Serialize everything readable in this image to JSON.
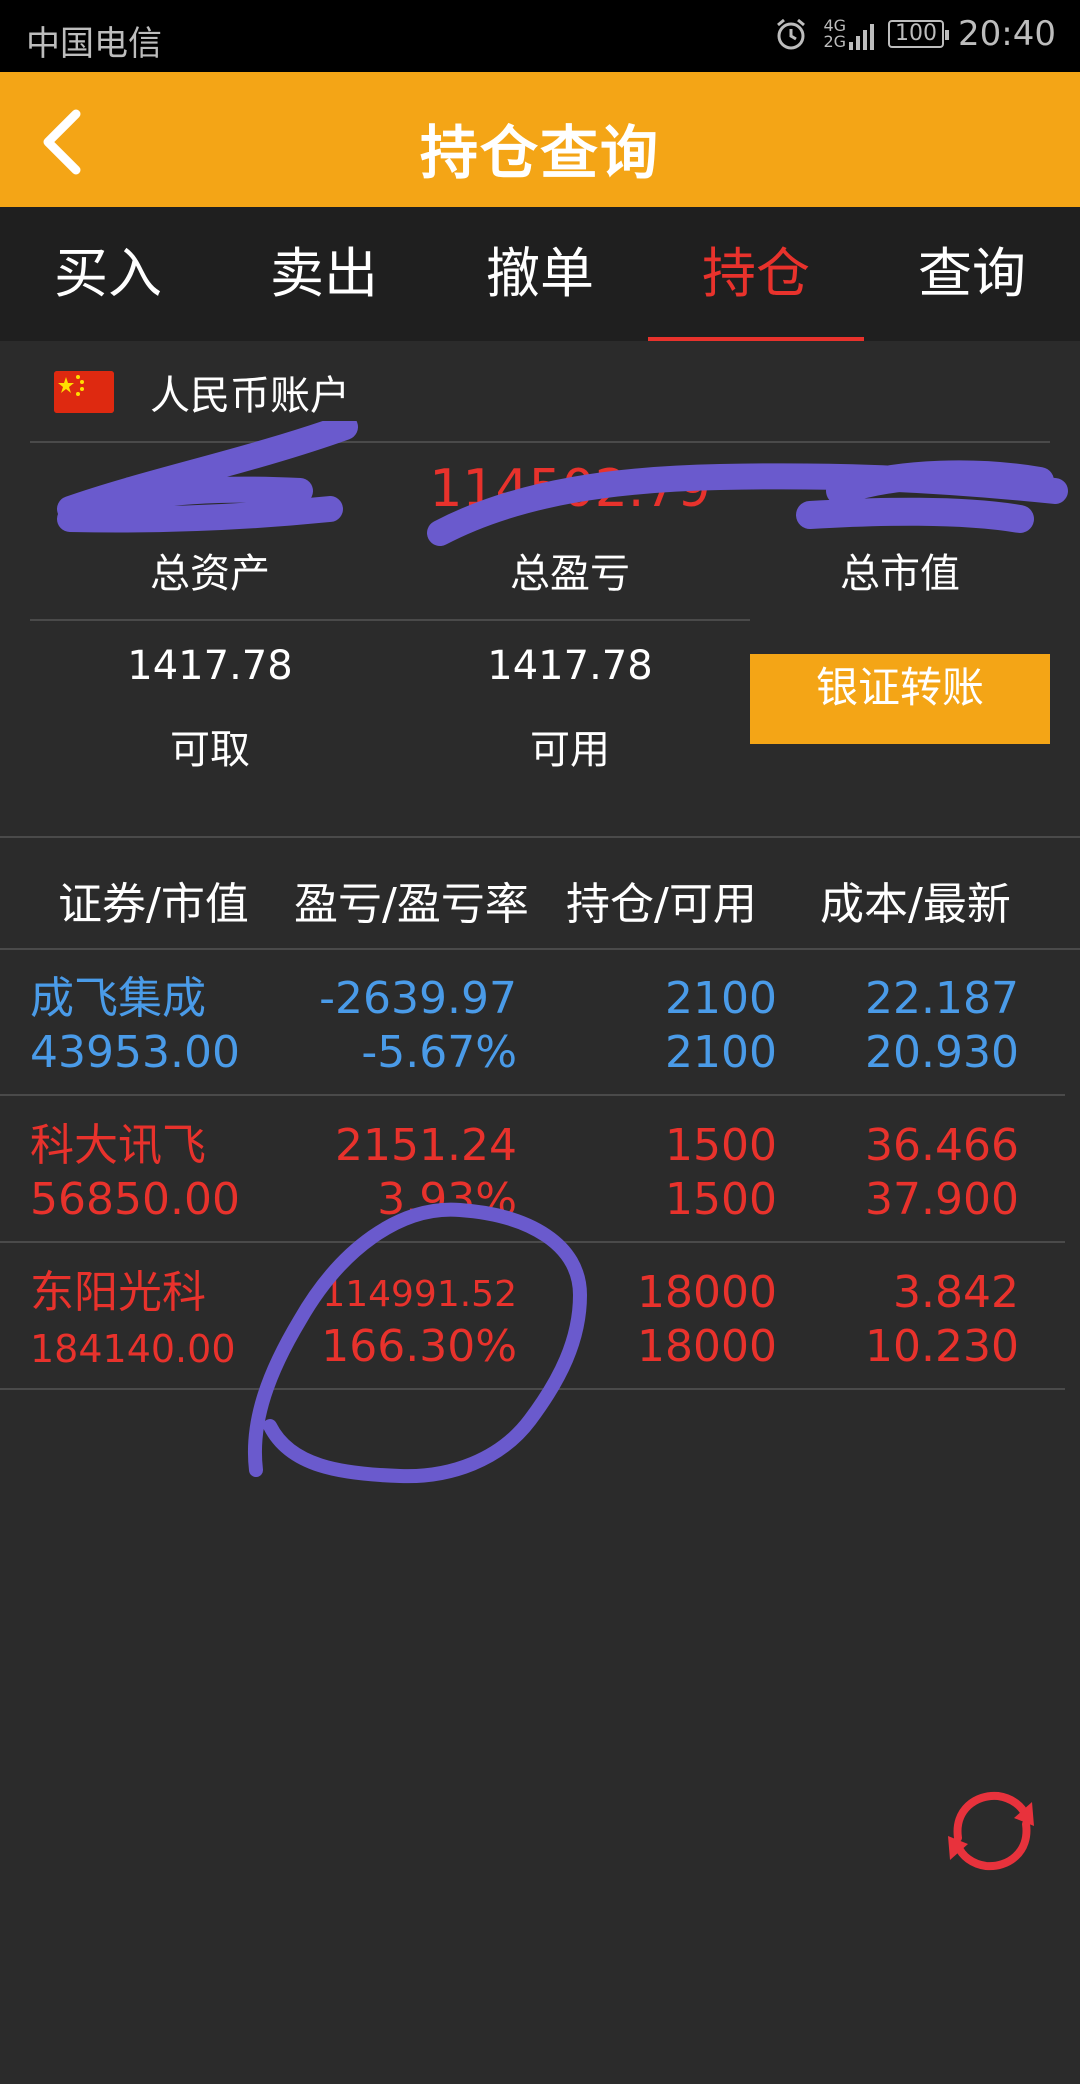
{
  "status_bar": {
    "carrier": "中国电信",
    "network": "4G",
    "network2": "2G",
    "battery": "100",
    "time": "20:40"
  },
  "header": {
    "title": "持仓查询"
  },
  "tabs": [
    "买入",
    "卖出",
    "撤单",
    "持仓",
    "查询"
  ],
  "active_tab": 3,
  "account": {
    "label": "人民币账户",
    "total_assets_label": "总资产",
    "total_pnl_label": "总盈亏",
    "total_pnl_value": "114502.79",
    "market_value_label": "总市值",
    "withdrawable_value": "1417.78",
    "withdrawable_label": "可取",
    "available_value": "1417.78",
    "available_label": "可用",
    "transfer_button": "银证转账"
  },
  "table": {
    "headers": [
      "证券/市值",
      "盈亏/盈亏率",
      "持仓/可用",
      "成本/最新"
    ],
    "rows": [
      {
        "name": "成飞集成",
        "market_value": "43953.00",
        "pnl": "-2639.97",
        "pnl_rate": "-5.67%",
        "position": "2100",
        "available": "2100",
        "cost": "22.187",
        "latest": "20.930",
        "color": "#4a9be8"
      },
      {
        "name": "科大讯飞",
        "market_value": "56850.00",
        "pnl": "2151.24",
        "pnl_rate": "3.93%",
        "position": "1500",
        "available": "1500",
        "cost": "36.466",
        "latest": "37.900",
        "color": "#e8322c"
      },
      {
        "name": "东阳光科",
        "market_value": "184140.00",
        "pnl": "114991.52",
        "pnl_rate": "166.30%",
        "position": "18000",
        "available": "18000",
        "cost": "3.842",
        "latest": "10.230",
        "color": "#e8322c"
      }
    ]
  },
  "refresh_icon": "refresh-icon",
  "colors": {
    "accent": "#f4a516",
    "active_tab": "#e8322c",
    "loss": "#4a9be8",
    "gain": "#e8322c",
    "annotation": "#6a5acd"
  }
}
